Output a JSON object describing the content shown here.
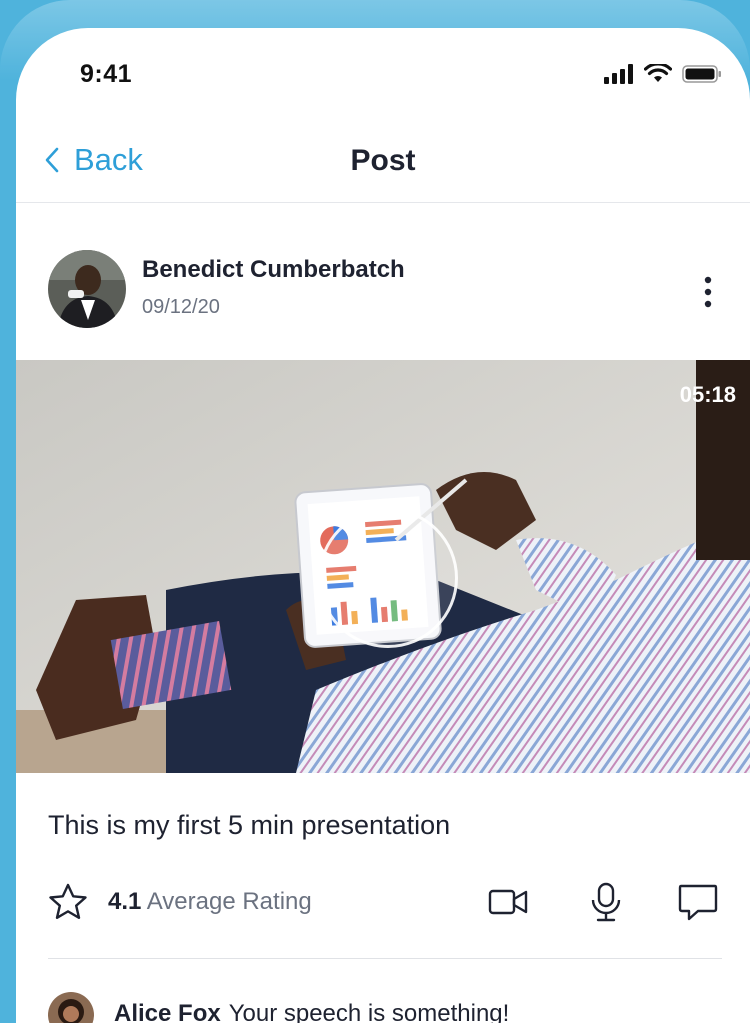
{
  "status_bar": {
    "time": "9:41"
  },
  "nav": {
    "back_label": "Back",
    "title": "Post"
  },
  "post": {
    "author_name": "Benedict Cumberbatch",
    "date": "09/12/20",
    "video_duration": "05:18",
    "caption": "This is my first 5 min presentation",
    "rating_value": "4.1",
    "rating_label": "Average Rating"
  },
  "comment": {
    "author": "Alice Fox",
    "text": "Your speech is something!"
  },
  "colors": {
    "accent": "#2e9fd8",
    "background": "#4fb3dc"
  },
  "icons": [
    "signal-icon",
    "wifi-icon",
    "battery-icon",
    "back-chevron-icon",
    "more-vertical-icon",
    "play-icon",
    "star-icon",
    "video-camera-icon",
    "microphone-icon",
    "comment-icon"
  ]
}
